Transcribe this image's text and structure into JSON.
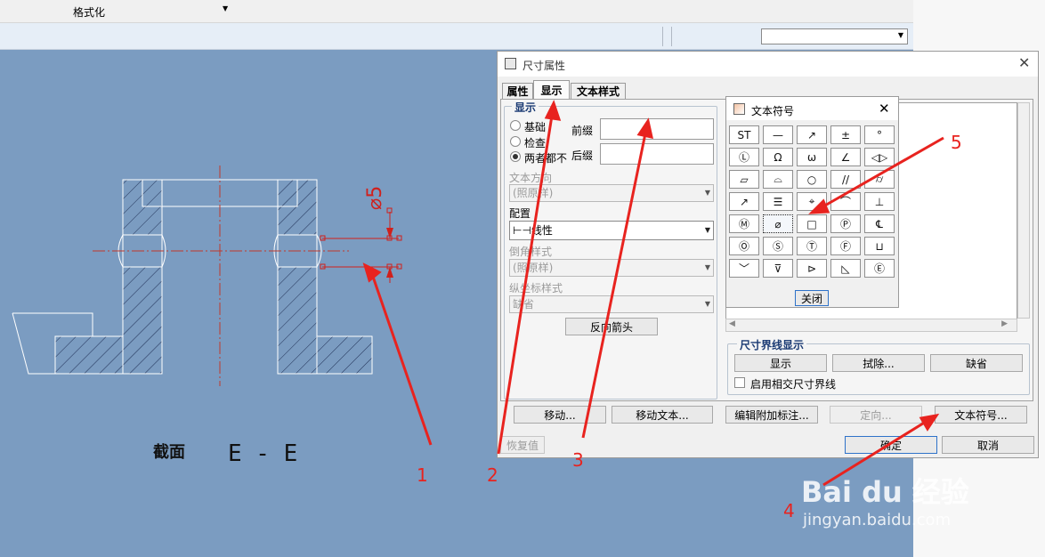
{
  "menubar": {
    "format_label": "格式化"
  },
  "drawing": {
    "section_label": "截面",
    "section_name": "E - E",
    "dim_text": "⌀5"
  },
  "dialog": {
    "title": "尺寸属性",
    "tabs": [
      {
        "label": "属性"
      },
      {
        "label": "显示"
      },
      {
        "label": "文本样式"
      }
    ],
    "display_group": "显示",
    "radios": [
      {
        "label": "基础",
        "checked": false
      },
      {
        "label": "检查",
        "checked": false
      },
      {
        "label": "两者都不",
        "checked": true
      }
    ],
    "prefix_label": "前缀",
    "suffix_label": "后缀",
    "text_dir_label": "文本方向",
    "text_dir_value": "(照原样)",
    "placement_label": "配置",
    "placement_value": "⊢⊣线性",
    "chamfer_label": "倒角样式",
    "chamfer_value": "(照原样)",
    "ordinate_label": "纵坐标样式",
    "ordinate_value": "缺省",
    "flip_arrows": "反向箭头",
    "witness_group": "尺寸界线显示",
    "witness_show": "显示",
    "witness_erase": "拭除...",
    "witness_default": "缺省",
    "intersect_label": "启用相交尺寸界线",
    "move": "移动...",
    "move_text": "移动文本...",
    "edit_attached": "编辑附加标注...",
    "orient": "定向...",
    "text_symbol": "文本符号...",
    "restore": "恢复值",
    "ok": "确定",
    "cancel": "取消"
  },
  "symbol_palette": {
    "title": "文本符号",
    "close": "关闭",
    "symbols": [
      "ST",
      "—",
      "↗",
      "±",
      "°",
      "Ⓛ",
      "Ω",
      "ω",
      "∠",
      "◁▷",
      "▱",
      "⌓",
      "○",
      "//",
      "⌭",
      "↗",
      "☰",
      "⌖",
      "⌒",
      "⊥",
      "Ⓜ",
      "⌀",
      "□",
      "Ⓟ",
      "℄",
      "Ⓞ",
      "Ⓢ",
      "Ⓣ",
      "Ⓕ",
      "⊔",
      "﹀",
      "⊽",
      "⊳",
      "◺",
      "Ⓔ"
    ]
  },
  "annotations": [
    "1",
    "2",
    "3",
    "4",
    "5"
  ],
  "watermark": {
    "brand": "Bai du 经验",
    "url": "jingyan.baidu.com"
  }
}
